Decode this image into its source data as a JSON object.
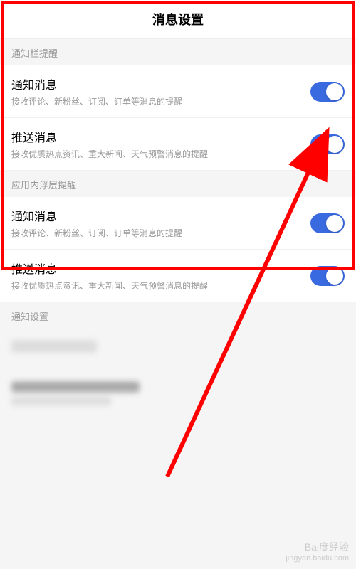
{
  "header": {
    "title": "消息设置"
  },
  "sections": {
    "notification_bar": {
      "header": "通知栏提醒",
      "items": [
        {
          "title": "通知消息",
          "desc": "接收评论、新粉丝、订阅、订单等消息的提醒",
          "enabled": true
        },
        {
          "title": "推送消息",
          "desc": "接收优质热点资讯、重大新闻、天气预警消息的提醒",
          "enabled": true
        }
      ]
    },
    "in_app": {
      "header": "应用内浮层提醒",
      "items": [
        {
          "title": "通知消息",
          "desc": "接收评论、新粉丝、订阅、订单等消息的提醒",
          "enabled": true
        },
        {
          "title": "推送消息",
          "desc": "接收优质热点资讯、重大新闻、天气预警消息的提醒",
          "enabled": true
        }
      ]
    },
    "notification_settings": {
      "header": "通知设置"
    }
  },
  "watermark": {
    "logo": "Bai度经验",
    "url": "jingyan.baidu.com"
  },
  "annotation": {
    "highlight_color": "#ff0000",
    "arrow_target": "push-message-toggle"
  }
}
